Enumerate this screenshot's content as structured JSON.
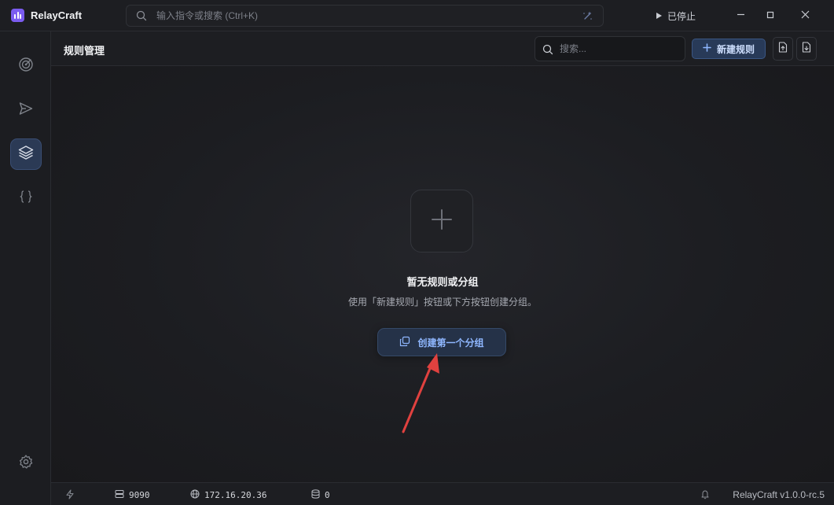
{
  "app": {
    "name": "RelayCraft"
  },
  "titlebar": {
    "command_placeholder": "输入指令或搜索 (Ctrl+K)",
    "proxy_status": "已停止",
    "icons": [
      "search-icon",
      "sparkle-icon",
      "play-icon",
      "minimize-icon",
      "maximize-icon",
      "close-icon"
    ]
  },
  "sidebar": {
    "items": [
      {
        "name": "traffic",
        "icon": "radar-icon",
        "active": false
      },
      {
        "name": "composer",
        "icon": "send-icon",
        "active": false
      },
      {
        "name": "rules",
        "icon": "layers-icon",
        "active": true
      },
      {
        "name": "scripts",
        "icon": "braces-icon",
        "active": false
      }
    ],
    "settings_icon": "gear-icon"
  },
  "header": {
    "title": "规则管理",
    "search_placeholder": "搜索...",
    "new_rule_label": "新建规则",
    "import_icon": "file-import-icon",
    "export_icon": "file-export-icon"
  },
  "empty_state": {
    "title": "暂无规则或分组",
    "description": "使用「新建规则」按钮或下方按钮创建分组。",
    "create_group_label": "创建第一个分组"
  },
  "statusbar": {
    "port": "9090",
    "ip": "172.16.20.36",
    "count": "0",
    "version": "RelayCraft v1.0.0-rc.5"
  },
  "colors": {
    "accent": "#4f8cff",
    "brand": "#7b5cf0",
    "annotation_arrow": "#e0413f"
  }
}
